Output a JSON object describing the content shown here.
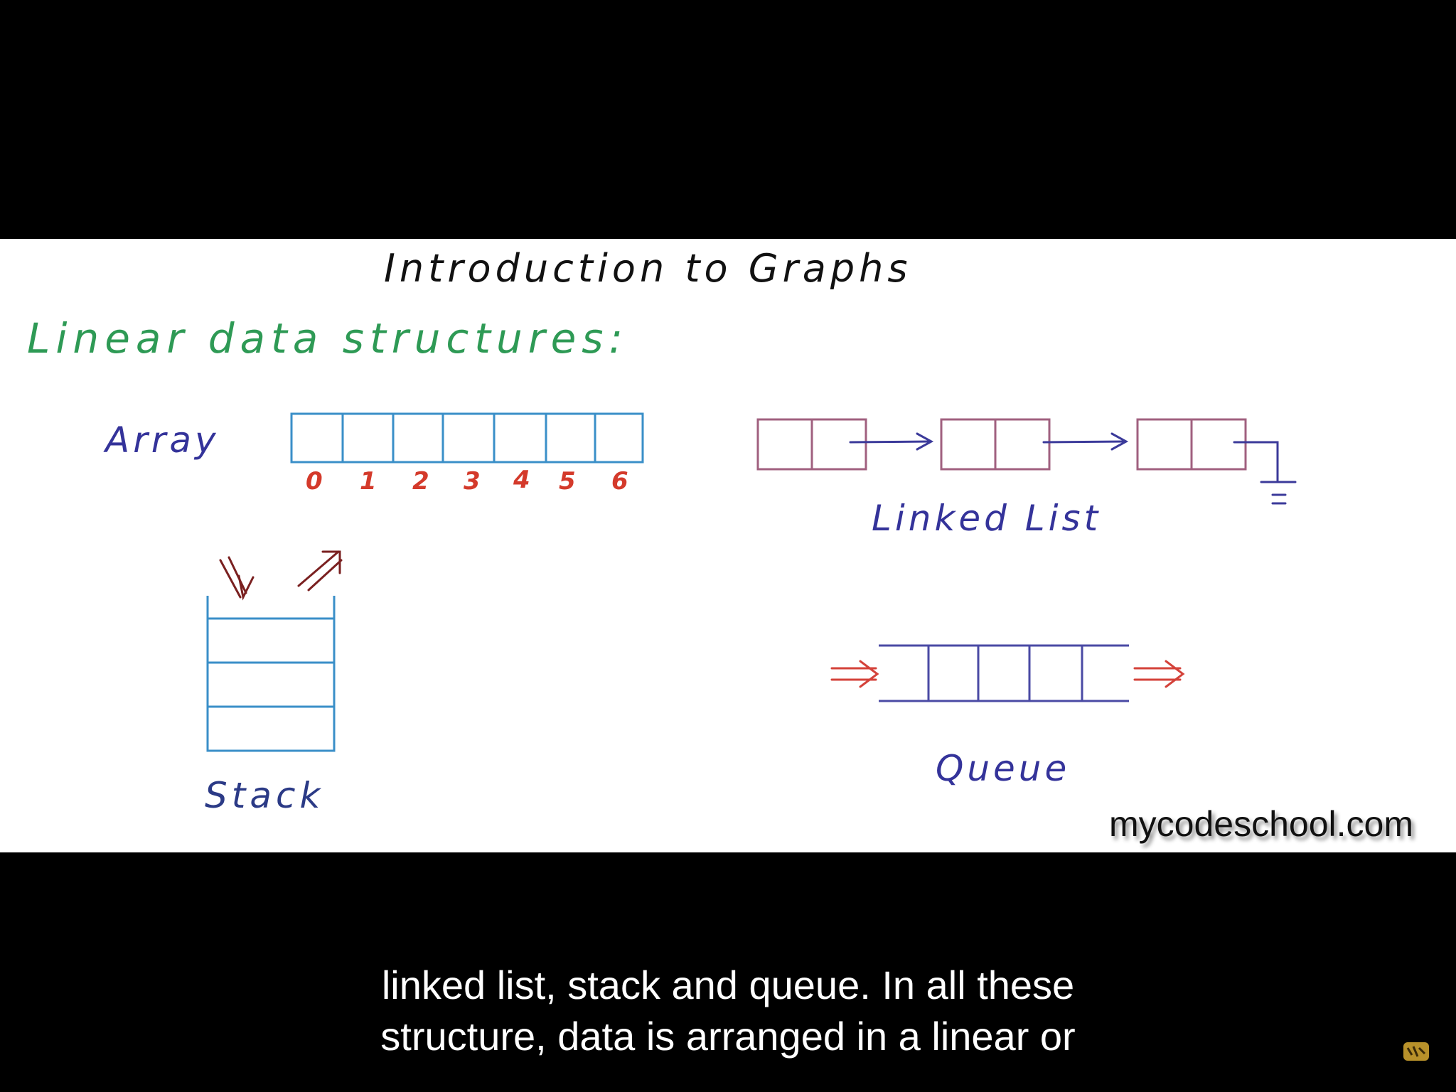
{
  "slide": {
    "title": "Introduction to Graphs",
    "heading": "Linear data structures:",
    "array": {
      "label": "Array",
      "indices": [
        "0",
        "1",
        "2",
        "3",
        "4",
        "5",
        "6"
      ]
    },
    "linked_list": {
      "label": "Linked List"
    },
    "stack": {
      "label": "Stack"
    },
    "queue": {
      "label": "Queue"
    },
    "watermark": "mycodeschool.com"
  },
  "captions": {
    "line1": "linked list, stack and queue. In all these",
    "line2": "structure, data is arranged in a linear or"
  },
  "colors": {
    "array_stroke": "#3a8fc8",
    "index_red": "#d43a2b",
    "linked_list_nodes": "#a0607f",
    "linked_list_arrows": "#3b3a9a",
    "queue_stroke": "#4a4aa4",
    "queue_arrows": "#d4423a",
    "stack_stroke": "#3a8fc8",
    "stack_arrows": "#7a2020",
    "heading_green": "#2e9a55"
  },
  "icons": {
    "channel_logo": "mycodeschool-logo-icon"
  }
}
